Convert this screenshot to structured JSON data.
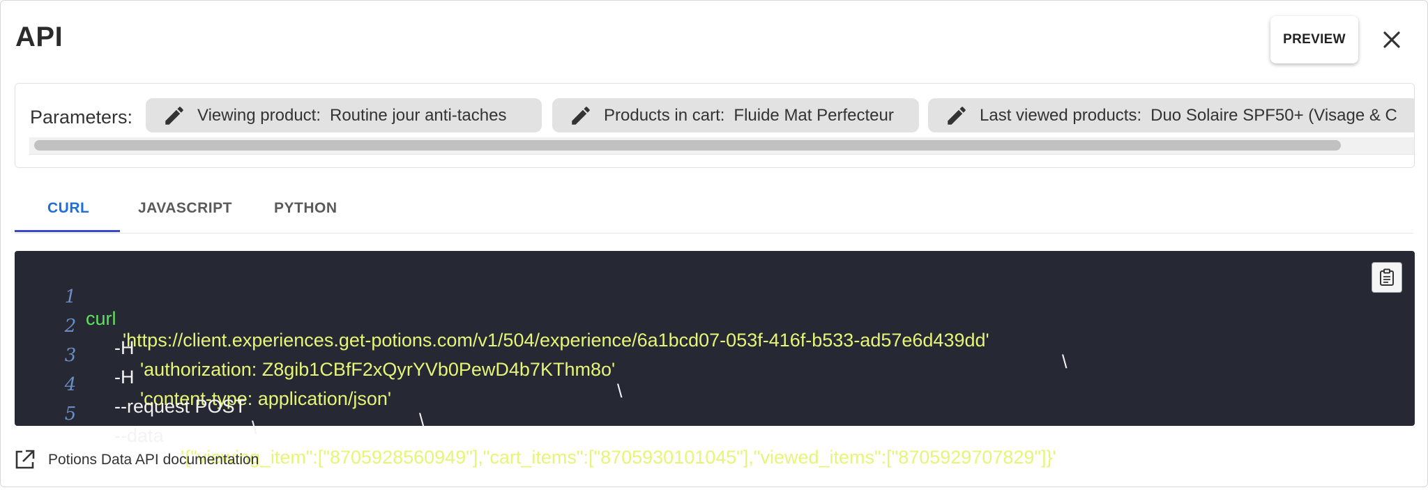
{
  "dialog": {
    "title": "API",
    "preview_label": "PREVIEW",
    "close_icon": "close-icon"
  },
  "parameters": {
    "label": "Parameters:",
    "chips": [
      {
        "key": "Viewing product:",
        "value": "Routine jour anti-taches",
        "icon": "pencil-icon"
      },
      {
        "key": "Products in cart:",
        "value": "Fluide Mat Perfecteur",
        "icon": "pencil-icon"
      },
      {
        "key": "Last viewed products:",
        "value": "Duo Solaire SPF50+ (Visage & C",
        "icon": "pencil-icon"
      }
    ]
  },
  "tabs": [
    {
      "label": "CURL",
      "active": true
    },
    {
      "label": "JAVASCRIPT",
      "active": false
    },
    {
      "label": "PYTHON",
      "active": false
    }
  ],
  "code": {
    "lines": [
      {
        "n": "1",
        "a": "curl",
        "b": "'https://client.experiences.get-potions.com/v1/504/experience/6a1bcd07-053f-416f-b533-ad57e6d439dd'",
        "c": "\\"
      },
      {
        "n": "2",
        "a": "-H",
        "b": "'authorization: Z8gib1CBfF2xQyrYVb0PewD4b7KThm8o'",
        "c": "\\"
      },
      {
        "n": "3",
        "a": "-H",
        "b": "'content-type: application/json'",
        "c": "\\"
      },
      {
        "n": "4",
        "a": "--request POST",
        "b": "",
        "c": "\\"
      },
      {
        "n": "5",
        "a": "--data",
        "b": "'{\"viewing_item\":[\"8705928560949\"],\"cart_items\":[\"8705930101045\"],\"viewed_items\":[\"8705929707829\"]}'",
        "c": ""
      }
    ],
    "copy_icon": "clipboard-icon"
  },
  "footer": {
    "doc_link_label": "Potions Data API documentation",
    "doc_link_icon": "external-link-icon"
  },
  "colors": {
    "accent": "#1e6fd9",
    "tab_indicator": "#3949c8",
    "code_bg": "#262833",
    "code_keyword": "#5fe35f",
    "code_string": "#e6f578"
  }
}
